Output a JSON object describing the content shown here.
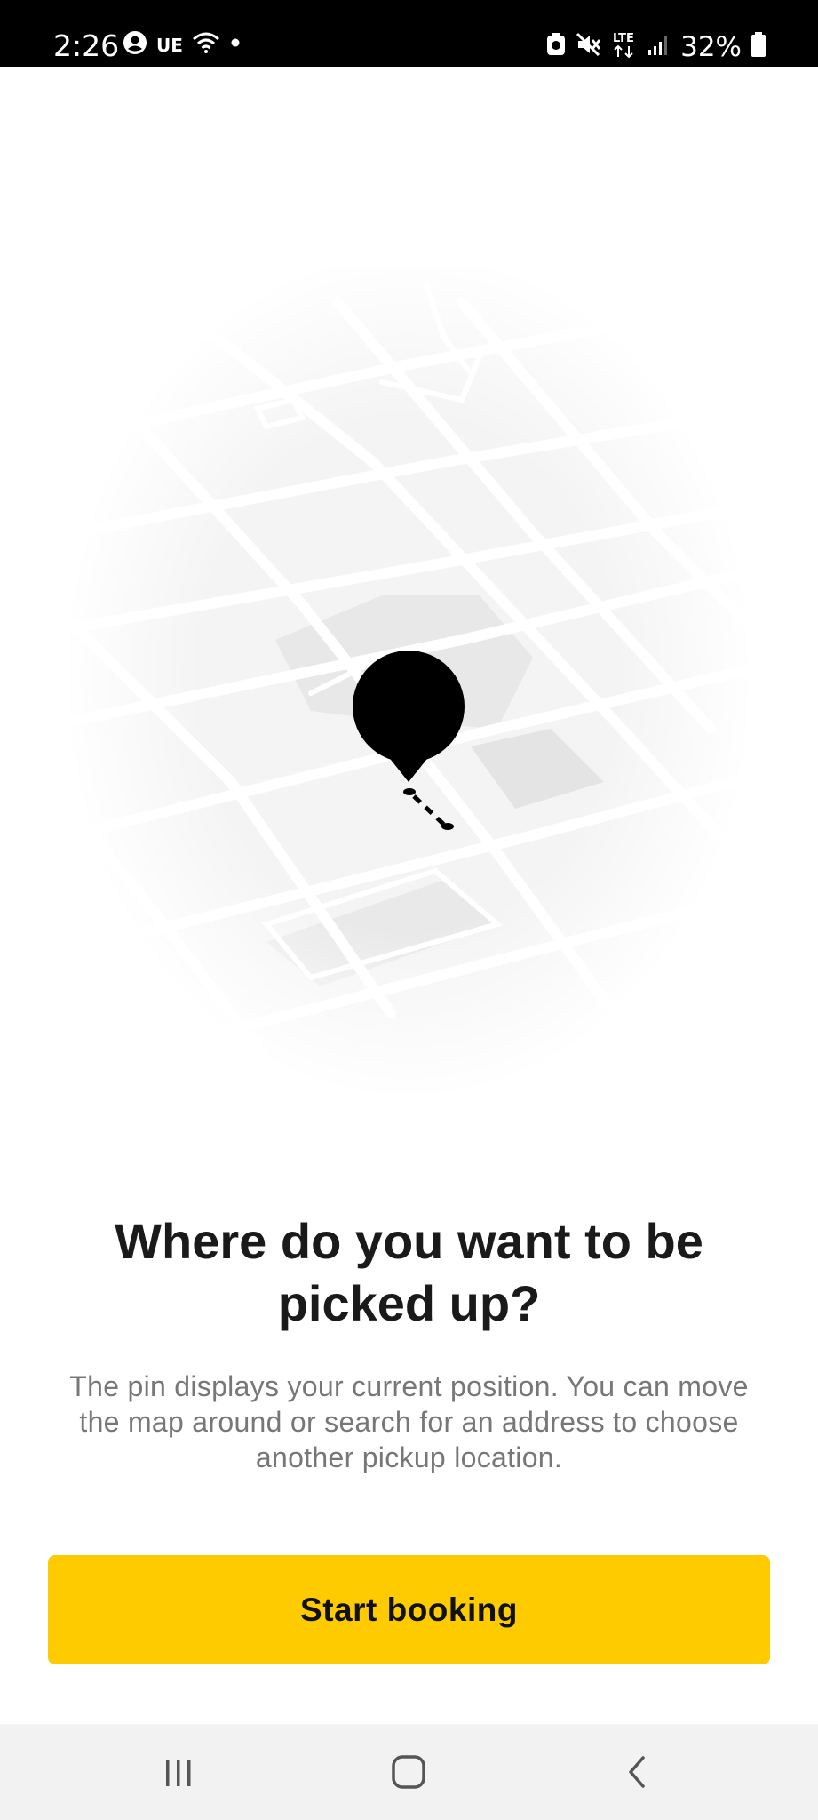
{
  "status_bar": {
    "time": "2:26",
    "carrier_icon": "UE",
    "network_label": "LTE",
    "battery": "32%",
    "icons_left": [
      "account-circle-icon",
      "ue-icon",
      "wifi-icon",
      "dot-icon"
    ],
    "icons_right": [
      "nfc-icon",
      "mute-icon",
      "lte-icon",
      "signal-icon",
      "battery-icon"
    ]
  },
  "illustration": {
    "description_icon": "map-pin-icon",
    "pin_color": "#000000"
  },
  "onboarding": {
    "title": "Where do you want to be picked up?",
    "body": "The pin displays your current position. You can move the map around or search for an address to choose another pickup location.",
    "cta_label": "Start booking",
    "cta_color": "#fdcb00"
  },
  "nav_bar": {
    "items": [
      "recents-icon",
      "home-icon",
      "back-icon"
    ]
  }
}
